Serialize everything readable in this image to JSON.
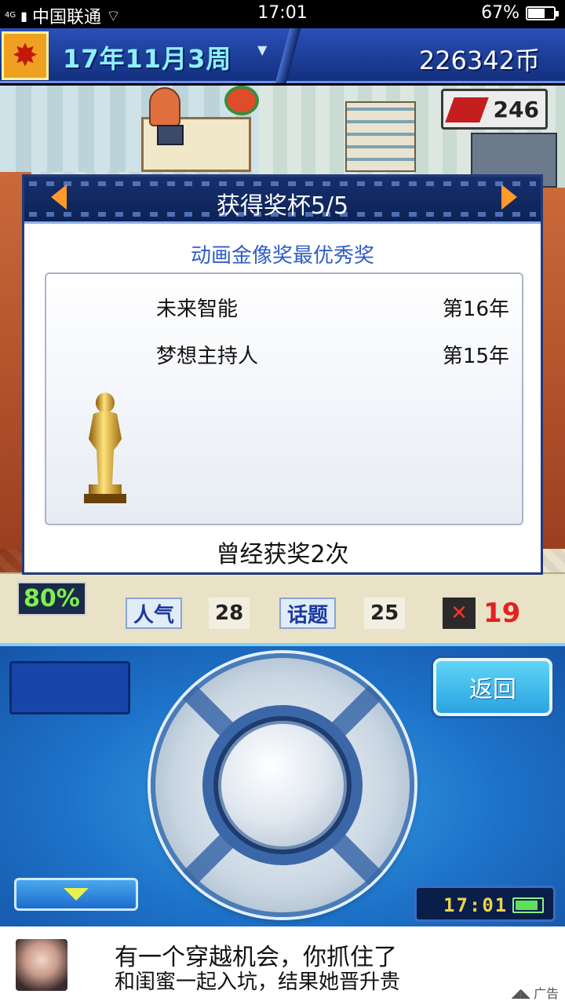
{
  "status_bar": {
    "network": "4G",
    "carrier": "中国联通",
    "time": "17:01",
    "battery": "67%",
    "battery_level": 0.67
  },
  "topbar": {
    "date": "17年11月3周",
    "money": "226342币",
    "research_points": "246"
  },
  "dialog": {
    "title": "获得奖杯5/5",
    "award_name": "动画金像奖最优秀奖",
    "works": [
      {
        "title": "未来智能",
        "year": "第16年"
      },
      {
        "title": "梦想主持人",
        "year": "第15年"
      }
    ],
    "award_count": "曾经获奖2次"
  },
  "stats": {
    "percent": "80%",
    "popularity_label": "人气",
    "popularity_value": "28",
    "topic_label": "话题",
    "topic_value": "25",
    "miss_value": "19"
  },
  "controls": {
    "back_label": "返回",
    "clock_time": "17:01"
  },
  "ad": {
    "line1": "有一个穿越机会，你抓住了",
    "line2": "和闺蜜一起入坑，结果她晋升贵",
    "tag": "广告"
  }
}
